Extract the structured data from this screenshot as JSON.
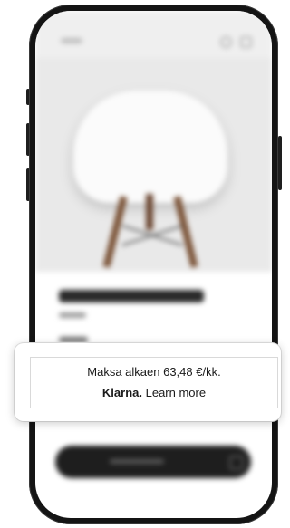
{
  "klarna_widget": {
    "installment_text": "Maksa alkaen 63,48 €/kk.",
    "brand": "Klarna.",
    "link_text": "Learn more"
  },
  "icons": [
    "search-icon",
    "cart-icon",
    "bag-icon"
  ]
}
